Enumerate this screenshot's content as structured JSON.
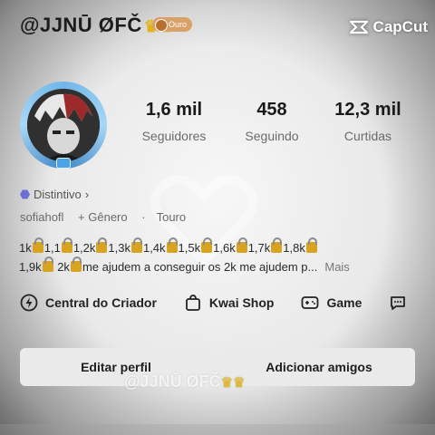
{
  "header": {
    "username": "@JJNŪ ØFČ",
    "badge_label": "Ouro",
    "watermark_brand": "CapCut"
  },
  "stats": [
    {
      "value": "1,6 mil",
      "label": "Seguidores"
    },
    {
      "value": "458",
      "label": "Seguindo"
    },
    {
      "value": "12,3 mil",
      "label": "Curtidas"
    }
  ],
  "profile": {
    "distintivo": "Distintivo",
    "handle": "sofiahofl",
    "gender": "+ Gênero",
    "zodiac": "Touro"
  },
  "bio": {
    "segments": [
      "1k",
      "1,1",
      "1,2k",
      "1,3k",
      "1,4k",
      "1,5k",
      "1,6k",
      "1,7k",
      "1,8k",
      "1,9k",
      "2k"
    ],
    "tail": "me ajudem a conseguir os 2k me ajudem p...",
    "more": "Mais"
  },
  "actions": [
    {
      "label": "Central do Criador",
      "icon": "lightning-icon"
    },
    {
      "label": "Kwai Shop",
      "icon": "shopping-bag-icon"
    },
    {
      "label": "Game",
      "icon": "gamepad-icon"
    }
  ],
  "buttons": {
    "edit_profile": "Editar perfil",
    "add_friends": "Adicionar amigos"
  },
  "overlay_text": "@JJNŪ ØFČ"
}
